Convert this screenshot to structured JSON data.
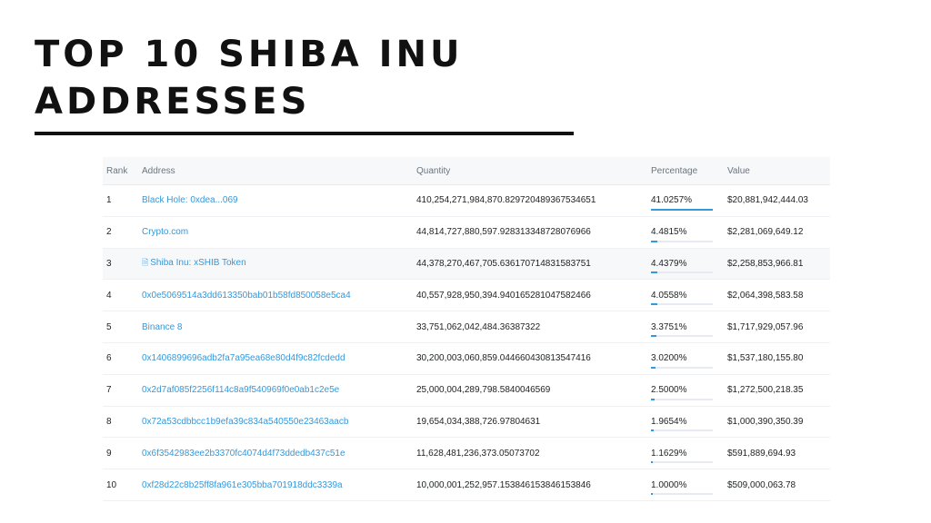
{
  "title_line1": "TOP 10 SHIBA INU",
  "title_line2": "ADDRESSES",
  "accent_color": "#3498db",
  "columns": [
    "Rank",
    "Address",
    "Quantity",
    "Percentage",
    "Value"
  ],
  "rows": [
    {
      "rank": "1",
      "address": "Black Hole: 0xdea...069",
      "quantity": "410,254,271,984,870.829720489367534651",
      "percentage": "41.0257%",
      "pct_value": 41.0257,
      "value": "$20,881,942,444.03"
    },
    {
      "rank": "2",
      "address": "Crypto.com",
      "quantity": "44,814,727,880,597.928313348728076966",
      "percentage": "4.4815%",
      "pct_value": 4.4815,
      "value": "$2,281,069,649.12"
    },
    {
      "rank": "3",
      "address": "Shiba Inu: xSHIB Token",
      "icon": "document-icon",
      "quantity": "44,378,270,467,705.636170714831583751",
      "percentage": "4.4379%",
      "pct_value": 4.4379,
      "value": "$2,258,853,966.81"
    },
    {
      "rank": "4",
      "address": "0x0e5069514a3dd613350bab01b58fd850058e5ca4",
      "quantity": "40,557,928,950,394.940165281047582466",
      "percentage": "4.0558%",
      "pct_value": 4.0558,
      "value": "$2,064,398,583.58"
    },
    {
      "rank": "5",
      "address": "Binance 8",
      "quantity": "33,751,062,042,484.36387322",
      "percentage": "3.3751%",
      "pct_value": 3.3751,
      "value": "$1,717,929,057.96"
    },
    {
      "rank": "6",
      "address": "0x1406899696adb2fa7a95ea68e80d4f9c82fcdedd",
      "quantity": "30,200,003,060,859.044660430813547416",
      "percentage": "3.0200%",
      "pct_value": 3.02,
      "value": "$1,537,180,155.80"
    },
    {
      "rank": "7",
      "address": "0x2d7af085f2256f114c8a9f540969f0e0ab1c2e5e",
      "quantity": "25,000,004,289,798.5840046569",
      "percentage": "2.5000%",
      "pct_value": 2.5,
      "value": "$1,272,500,218.35"
    },
    {
      "rank": "8",
      "address": "0x72a53cdbbcc1b9efa39c834a540550e23463aacb",
      "quantity": "19,654,034,388,726.97804631",
      "percentage": "1.9654%",
      "pct_value": 1.9654,
      "value": "$1,000,390,350.39"
    },
    {
      "rank": "9",
      "address": "0x6f3542983ee2b3370fc4074d4f73ddedb437c51e",
      "quantity": "11,628,481,236,373.05073702",
      "percentage": "1.1629%",
      "pct_value": 1.1629,
      "value": "$591,889,694.93"
    },
    {
      "rank": "10",
      "address": "0xf28d22c8b25ff8fa961e305bba701918ddc3339a",
      "quantity": "10,000,001,252,957.153846153846153846",
      "percentage": "1.0000%",
      "pct_value": 1.0,
      "value": "$509,000,063.78"
    }
  ]
}
